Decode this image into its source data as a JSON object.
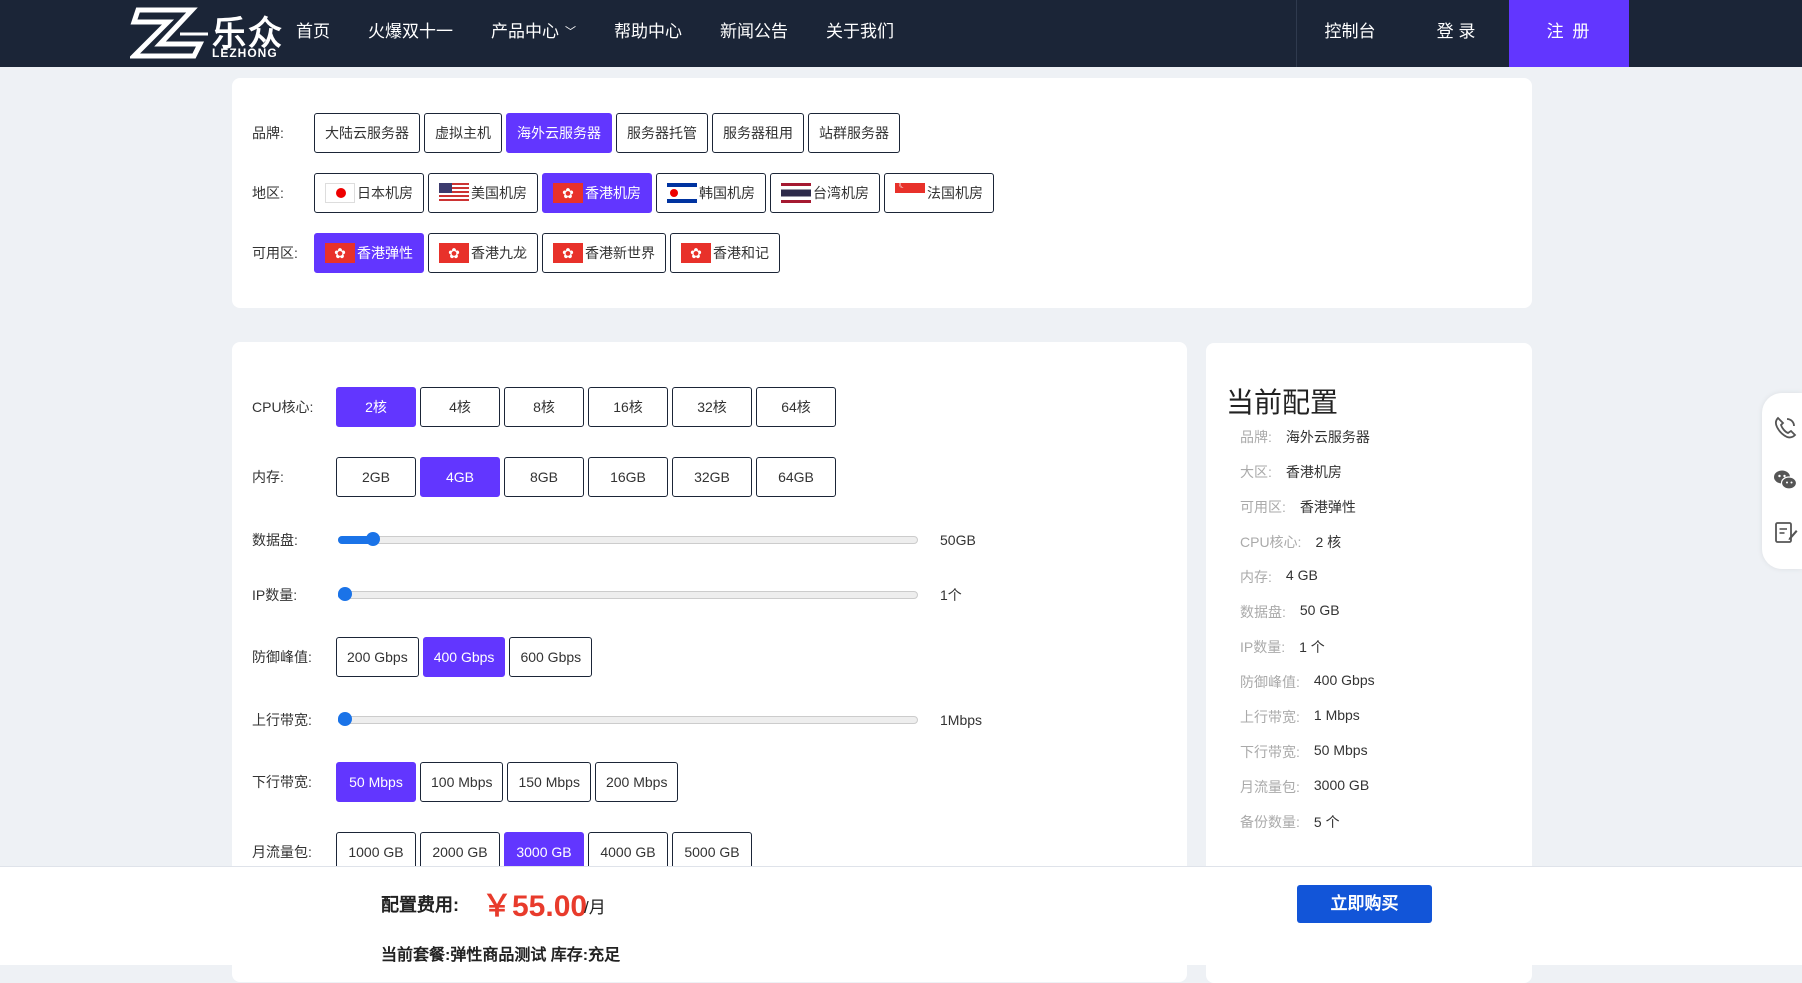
{
  "header": {
    "logo_cn": "乐众",
    "logo_en": "LEZHONG",
    "nav": [
      "首页",
      "火爆双十一",
      "产品中心",
      "帮助中心",
      "新闻公告",
      "关于我们"
    ],
    "console": "控制台",
    "login": "登 录",
    "register": "注 册"
  },
  "filters": {
    "brand": {
      "label": "品牌:",
      "options": [
        "大陆云服务器",
        "虚拟主机",
        "海外云服务器",
        "服务器托管",
        "服务器租用",
        "站群服务器"
      ],
      "selected": 2
    },
    "region": {
      "label": "地区:",
      "options": [
        "日本机房",
        "美国机房",
        "香港机房",
        "韩国机房",
        "台湾机房",
        "法国机房"
      ],
      "selected": 2
    },
    "zone": {
      "label": "可用区:",
      "options": [
        "香港弹性",
        "香港九龙",
        "香港新世界",
        "香港和记"
      ],
      "selected": 0
    }
  },
  "config": {
    "cpu": {
      "label": "CPU核心:",
      "options": [
        "2核",
        "4核",
        "8核",
        "16核",
        "32核",
        "64核"
      ],
      "selected": 0
    },
    "memory": {
      "label": "内存:",
      "options": [
        "2GB",
        "4GB",
        "8GB",
        "16GB",
        "32GB",
        "64GB"
      ],
      "selected": 1
    },
    "disk": {
      "label": "数据盘:",
      "value": "50GB",
      "level": 0.05
    },
    "ip": {
      "label": "IP数量:",
      "value": "1个",
      "level": 0
    },
    "defense": {
      "label": "防御峰值:",
      "options": [
        "200 Gbps",
        "400 Gbps",
        "600 Gbps"
      ],
      "selected": 1
    },
    "upload": {
      "label": "上行带宽:",
      "value": "1Mbps",
      "level": 0
    },
    "download": {
      "label": "下行带宽:",
      "options": [
        "50 Mbps",
        "100 Mbps",
        "150 Mbps",
        "200 Mbps"
      ],
      "selected": 0
    },
    "traffic": {
      "label": "月流量包:",
      "options": [
        "1000 GB",
        "2000 GB",
        "3000 GB",
        "4000 GB",
        "5000 GB"
      ],
      "selected": 2
    }
  },
  "summary": {
    "title": "当前配置",
    "rows": [
      {
        "k": "品牌:",
        "v": "海外云服务器"
      },
      {
        "k": "大区:",
        "v": "香港机房"
      },
      {
        "k": "可用区:",
        "v": "香港弹性"
      },
      {
        "k": "CPU核心:",
        "v": "2 核"
      },
      {
        "k": "内存:",
        "v": "4 GB"
      },
      {
        "k": "数据盘:",
        "v": "50 GB"
      },
      {
        "k": "IP数量:",
        "v": "1 个"
      },
      {
        "k": "防御峰值:",
        "v": "400 Gbps"
      },
      {
        "k": "上行带宽:",
        "v": "1 Mbps"
      },
      {
        "k": "下行带宽:",
        "v": "50 Mbps"
      },
      {
        "k": "月流量包:",
        "v": "3000 GB"
      },
      {
        "k": "备份数量:",
        "v": "5 个"
      }
    ]
  },
  "footer": {
    "fee_label": "配置费用:",
    "price": "￥55.00",
    "unit": "/月",
    "buy": "立即购买",
    "plan": "当前套餐:弹性商品测试 库存:充足"
  },
  "float_icons": [
    "phone-icon",
    "wechat-icon",
    "feedback-icon"
  ],
  "colors": {
    "accent": "#6236ff",
    "header_bg": "#1b2537",
    "price": "#e83b2c",
    "buy": "#1255d8"
  }
}
